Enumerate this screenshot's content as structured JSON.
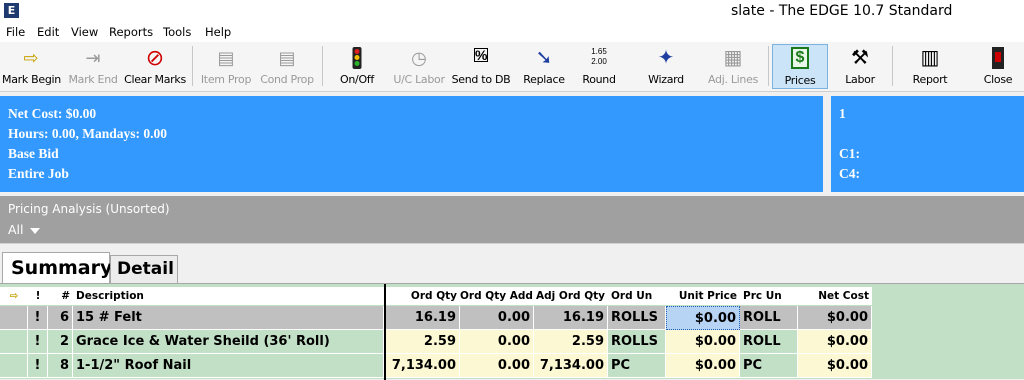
{
  "window": {
    "app_icon": "E",
    "title": "slate - The EDGE 10.7 Standard"
  },
  "menu": [
    "File",
    "Edit",
    "View",
    "Reports",
    "Tools",
    "Help"
  ],
  "toolbar": [
    {
      "id": "mark-begin",
      "label": "Mark Begin",
      "icon": "arrow-right-icon",
      "glyph": "⇨",
      "color": "#c8a000",
      "enabled": true
    },
    {
      "id": "mark-end",
      "label": "Mark End",
      "icon": "arrow-updown-icon",
      "glyph": "⇥",
      "color": "#9a9a9a",
      "enabled": false
    },
    {
      "id": "clear-marks",
      "label": "Clear Marks",
      "icon": "no-symbol-icon",
      "glyph": "⊘",
      "color": "#d00000",
      "enabled": true
    },
    {
      "id": "item-prop",
      "label": "Item Prop",
      "icon": "document-icon",
      "glyph": "▤",
      "color": "#9a9a9a",
      "enabled": false
    },
    {
      "id": "cond-prop",
      "label": "Cond Prop",
      "icon": "document-icon",
      "glyph": "▤",
      "color": "#9a9a9a",
      "enabled": false
    },
    {
      "id": "on-off",
      "label": "On/Off",
      "icon": "traffic-light-icon",
      "glyph": "●",
      "color": "#2b9a2b",
      "enabled": true
    },
    {
      "id": "uc-labor",
      "label": "U/C Labor",
      "icon": "clock-icon",
      "glyph": "◷",
      "color": "#9a9a9a",
      "enabled": false
    },
    {
      "id": "send-to-db",
      "label": "Send to DB",
      "icon": "percent-db-icon",
      "glyph": "%",
      "color": "#000000",
      "enabled": true
    },
    {
      "id": "replace",
      "label": "Replace",
      "icon": "replace-arrow-icon",
      "glyph": "➘",
      "color": "#1f3fa0",
      "enabled": true
    },
    {
      "id": "round",
      "label": "Round",
      "icon": "round-numbers-icon",
      "glyph_top": "1.65",
      "glyph_bottom": "2.00",
      "color": "#000000",
      "enabled": true
    },
    {
      "id": "wizard",
      "label": "Wizard",
      "icon": "wizard-icon",
      "glyph": "✦",
      "color": "#1f3fa0",
      "enabled": true
    },
    {
      "id": "adj-lines",
      "label": "Adj. Lines",
      "icon": "calculator-icon",
      "glyph": "▦",
      "color": "#9a9a9a",
      "enabled": false
    },
    {
      "id": "prices",
      "label": "Prices",
      "icon": "dollar-icon",
      "glyph": "$",
      "color": "#1a7a1a",
      "enabled": true,
      "active": true
    },
    {
      "id": "labor",
      "label": "Labor",
      "icon": "labor-icon",
      "glyph": "⚒",
      "color": "#000000",
      "enabled": true
    },
    {
      "id": "report",
      "label": "Report",
      "icon": "report-icon",
      "glyph": "▥",
      "color": "#000000",
      "enabled": true
    },
    {
      "id": "close",
      "label": "Close",
      "icon": "close-door-icon",
      "glyph": "▮",
      "color": "#cc0000",
      "enabled": true
    }
  ],
  "info_left": {
    "net_cost": "Net Cost: $0.00",
    "hours": "Hours: 0.00, Mandays: 0.00",
    "bid": "Base Bid",
    "scope": "Entire Job"
  },
  "info_right": {
    "line1": "1",
    "c1": "C1:",
    "c4": "C4:"
  },
  "analysis": {
    "title": "Pricing Analysis (Unsorted)",
    "filter": "All"
  },
  "tabs": {
    "summary": "Summary",
    "detail": "Detail"
  },
  "table": {
    "headers": {
      "mark": "⇨",
      "flag": "!",
      "num": "#",
      "description": "Description",
      "ord_qty": "Ord Qty",
      "ord_qty_add": "Ord Qty Add",
      "adj_ord_qty": "Adj Ord Qty",
      "ord_un": "Ord Un",
      "unit_price": "Unit Price",
      "prc_un": "Prc Un",
      "net_cost": "Net Cost"
    },
    "rows": [
      {
        "flag": "!",
        "num": "6",
        "description": "15 # Felt",
        "ord_qty": "16.19",
        "ord_qty_add": "0.00",
        "adj_ord_qty": "16.19",
        "ord_un": "ROLLS",
        "unit_price": "$0.00",
        "prc_un": "ROLL",
        "net_cost": "$0.00"
      },
      {
        "flag": "!",
        "num": "2",
        "description": "Grace Ice & Water Sheild (36' Roll)",
        "ord_qty": "2.59",
        "ord_qty_add": "0.00",
        "adj_ord_qty": "2.59",
        "ord_un": "ROLLS",
        "unit_price": "$0.00",
        "prc_un": "ROLL",
        "net_cost": "$0.00"
      },
      {
        "flag": "!",
        "num": "8",
        "description": "1-1/2\" Roof Nail",
        "ord_qty": "7,134.00",
        "ord_qty_add": "0.00",
        "adj_ord_qty": "7,134.00",
        "ord_un": "PC",
        "unit_price": "$0.00",
        "prc_un": "PC",
        "net_cost": "$0.00"
      }
    ]
  }
}
